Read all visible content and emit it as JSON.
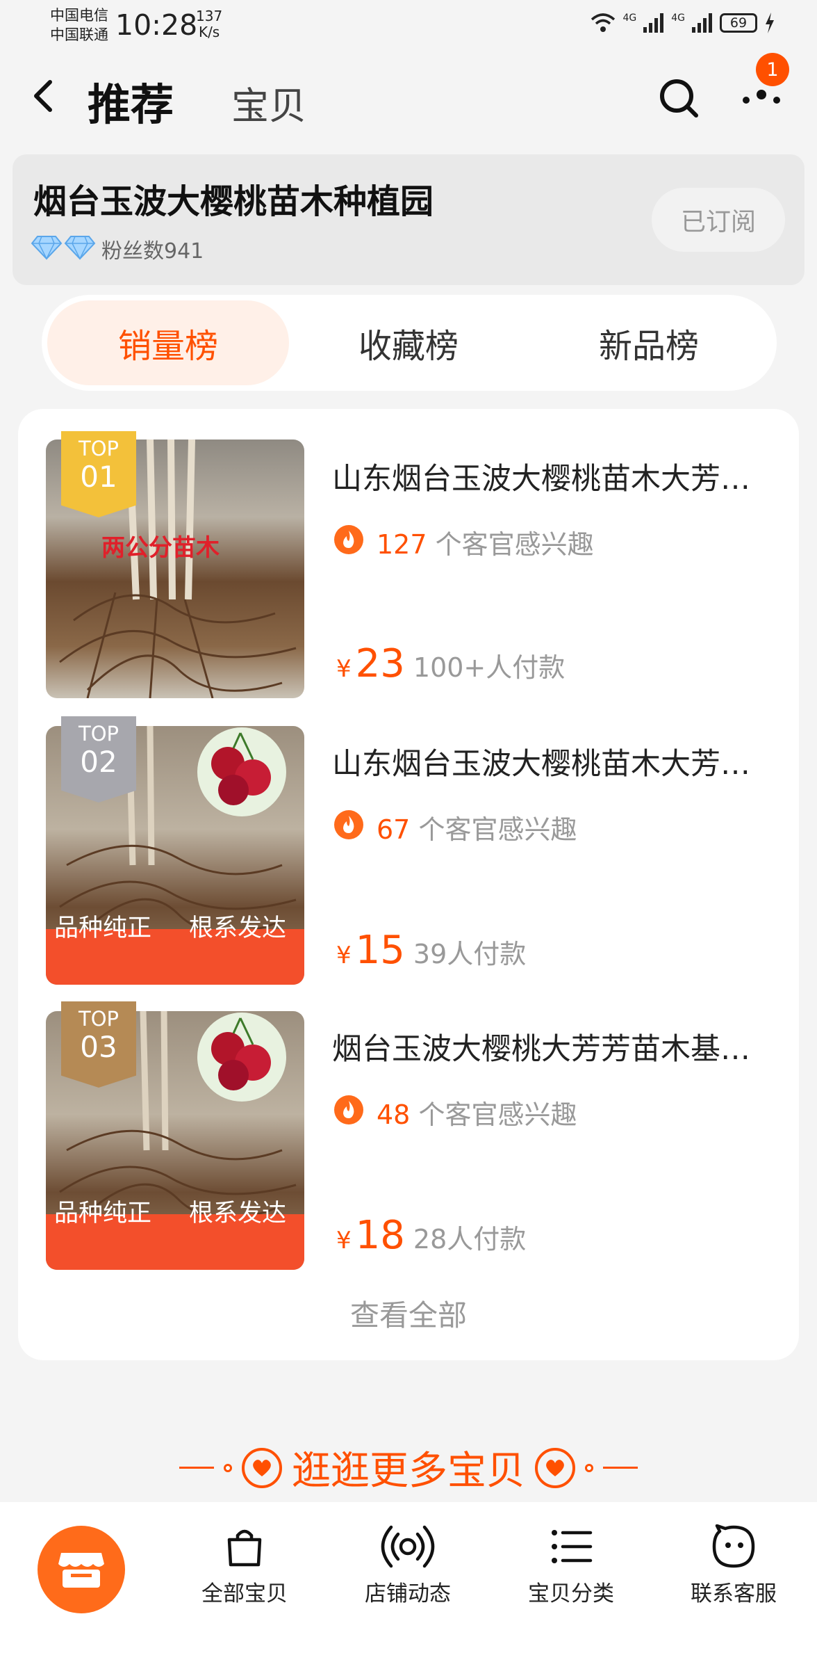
{
  "status_bar": {
    "carrier1": "中国电信",
    "carrier2": "中国联通",
    "time": "10:28",
    "speed_value": "137",
    "speed_unit": "K/s",
    "network1": "4G",
    "network2": "4G",
    "battery": "69"
  },
  "nav": {
    "title": "推荐",
    "tab2": "宝贝",
    "badge_count": "1"
  },
  "shop": {
    "name": "烟台玉波大樱桃苗木种植园",
    "fans": "粉丝数941",
    "subscribe_label": "已订阅"
  },
  "rank_tabs": [
    {
      "label": "销量榜",
      "active": true
    },
    {
      "label": "收藏榜",
      "active": false
    },
    {
      "label": "新品榜",
      "active": false
    }
  ],
  "products": [
    {
      "rank_top": "TOP",
      "rank_num": "01",
      "image_caption": "两公分苗木",
      "title": "山东烟台玉波大樱桃苗木大芳芳大樱桃苗木基地直发",
      "interest_count": "127",
      "interest_text": "个客官感兴趣",
      "currency": "¥",
      "price": "23",
      "paid": "100+人付款"
    },
    {
      "rank_top": "TOP",
      "rank_num": "02",
      "image_banner_left": "品种纯正",
      "image_banner_right": "根系发达",
      "title": "山东烟台玉波大樱桃苗木大芳芳大樱桃苗木基地直发",
      "interest_count": "67",
      "interest_text": "个客官感兴趣",
      "currency": "¥",
      "price": "15",
      "paid": "39人付款"
    },
    {
      "rank_top": "TOP",
      "rank_num": "03",
      "image_banner_left": "品种纯正",
      "image_banner_right": "根系发达",
      "title": "烟台玉波大樱桃大芳芳苗木基地直发大樱桃苗木",
      "interest_count": "48",
      "interest_text": "个客官感兴趣",
      "currency": "¥",
      "price": "18",
      "paid": "28人付款"
    }
  ],
  "view_all": "查看全部",
  "more_section": "逛逛更多宝贝",
  "bottom_tabs": [
    {
      "label": "全部宝贝",
      "icon": "shopping-bag-icon"
    },
    {
      "label": "店铺动态",
      "icon": "broadcast-icon"
    },
    {
      "label": "宝贝分类",
      "icon": "list-icon"
    },
    {
      "label": "联系客服",
      "icon": "chat-face-icon"
    }
  ],
  "colors": {
    "accent": "#ff5000",
    "rank1": "#f3c13a",
    "rank2": "#a7a7ad",
    "rank3": "#b58a55"
  }
}
